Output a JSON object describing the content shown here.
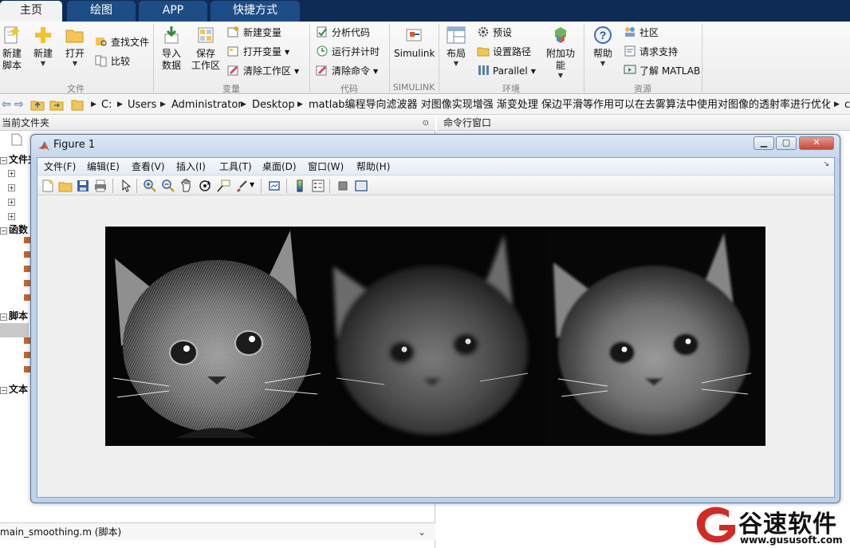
{
  "tabs": [
    {
      "label": "主页",
      "active": true
    },
    {
      "label": "绘图",
      "active": false
    },
    {
      "label": "APP",
      "active": false
    },
    {
      "label": "快捷方式",
      "active": false
    }
  ],
  "ribbon": {
    "file": {
      "section_label": "文件",
      "new_script_line1": "新建",
      "new_script_line2": "脚本",
      "new_label": "新建",
      "open_label": "打开",
      "find_files_label": "查找文件",
      "compare_label": "比较"
    },
    "variable": {
      "section_label": "变量",
      "import_line1": "导入",
      "import_line2": "数据",
      "save_ws_line1": "保存",
      "save_ws_line2": "工作区",
      "new_var_label": "新建变量",
      "open_var_label": "打开变量",
      "clear_ws_label": "清除工作区"
    },
    "code": {
      "section_label": "代码",
      "analyze_label": "分析代码",
      "run_time_label": "运行并计时",
      "clear_cmd_label": "清除命令"
    },
    "simulink": {
      "section_label": "SIMULINK",
      "simulink_label": "Simulink"
    },
    "environment": {
      "section_label": "环境",
      "layout_label": "布局",
      "prefs_label": "预设",
      "set_path_label": "设置路径",
      "parallel_label": "Parallel",
      "addons_label": "附加功能"
    },
    "resources": {
      "section_label": "资源",
      "help_label": "帮助",
      "community_label": "社区",
      "request_support_label": "请求支持",
      "learn_matlab_label": "了解 MATLAB"
    }
  },
  "address": {
    "crumbs": [
      "C:",
      "Users",
      "Administrator",
      "Desktop",
      "matlab编程导向滤波器 对图像实现增强 渐变处理 保边平滑等作用可以在去雾算法中使用对图像的透射率进行优化源码程序",
      "c"
    ]
  },
  "left_panel": {
    "header": "当前文件夹",
    "groups": [
      "文件夹",
      "函数",
      "脚本",
      "文本"
    ],
    "bottom_file": "main_smoothing.m  (脚本)"
  },
  "right_panel": {
    "header": "命令行窗口"
  },
  "figure": {
    "title": "Figure 1",
    "menu": [
      "文件(F)",
      "编辑(E)",
      "查看(V)",
      "插入(I)",
      "工具(T)",
      "桌面(D)",
      "窗口(W)",
      "帮助(H)"
    ]
  },
  "watermark": {
    "brand": "谷速软件",
    "url": "www.gususoft.com"
  },
  "colors": {
    "tabbar": "#0e2b55",
    "tab_inactive": "#1d4d86",
    "ribbon": "#f0f0f0",
    "watermark_red": "#d42a25"
  }
}
